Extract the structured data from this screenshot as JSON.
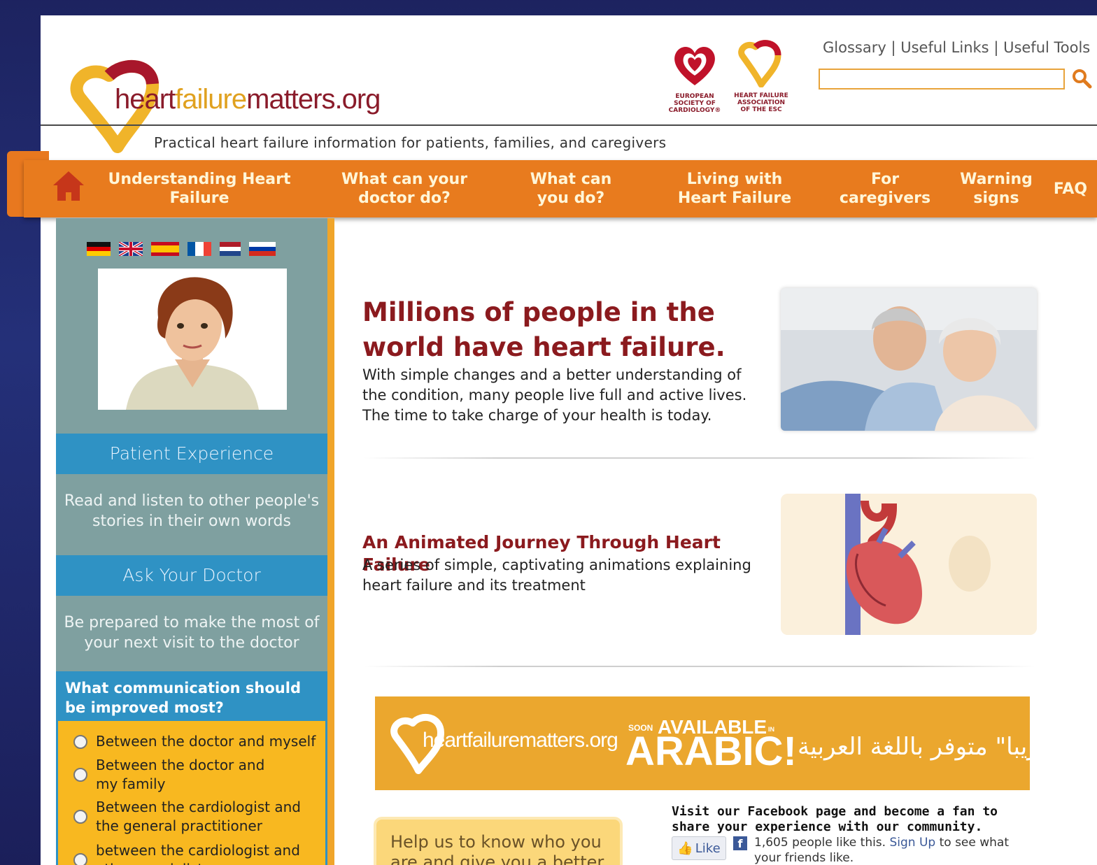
{
  "header": {
    "logo_main": "heart",
    "logo_accent": "failure",
    "logo_rest": "matters.org",
    "tagline": "Practical heart failure information for patients, families, and caregivers",
    "esc_caption": "EUROPEAN SOCIETY OF CARDIOLOGY®",
    "hfa_caption": "HEART FAILURE ASSOCIATION OF THE ESC",
    "links": [
      "Glossary",
      "Useful Links",
      "Useful Tools"
    ],
    "link_separator": "|",
    "search_value": ""
  },
  "nav": {
    "items": [
      {
        "label": "Understanding Heart Failure"
      },
      {
        "label": "What can your doctor do?"
      },
      {
        "label": "What can you do?"
      },
      {
        "label": "Living with Heart Failure"
      },
      {
        "label": "For caregivers"
      },
      {
        "label": "Warning signs"
      },
      {
        "label": "FAQ"
      }
    ]
  },
  "sidebar": {
    "patient_title": "Patient Experience",
    "patient_text": "Read and listen to other people's stories in their own words",
    "doctor_title": "Ask Your Doctor",
    "doctor_text": "Be prepared to make the most of your next visit to the doctor",
    "poll": {
      "question": "What communication should be improved most?",
      "options": [
        "Between the doctor and myself",
        "Between the doctor and my family",
        "Between the cardiologist and the general practitioner",
        "between the cardiologist and other specialists"
      ]
    }
  },
  "main": {
    "feature1": {
      "title": "Millions of people in the world have heart failure.",
      "text": "With simple changes and a better understanding of the condition, many people live full and active lives. The time to take charge of your health is today."
    },
    "feature2": {
      "title": "An Animated Journey Through Heart Failure",
      "text": "A series of simple, captivating animations explaining heart failure and its treatment"
    },
    "banner": {
      "logo": "heartfailurematters.org",
      "soon": "SOON",
      "available": "AVAILABLE",
      "in": "IN",
      "language": "ARABIC!",
      "arabic": "قريبا\" متوفر باللغة العربية"
    },
    "help_text": "Help us to know who you are and give you a better service",
    "facebook": {
      "heading": "Visit our Facebook page and become a fan to share your experience with our community.",
      "like_label": "Like",
      "count_text": "1,605 people like this.",
      "signup_link": "Sign Up",
      "tail_text": "to see what your friends like."
    }
  },
  "colors": {
    "nav_orange": "#e87b1e",
    "sidebar_teal": "#7fa0a0",
    "sidebar_blue": "#2f92c4",
    "poll_yellow": "#f8b820",
    "title_red": "#8b1a1e",
    "banner_gold": "#eba72e"
  }
}
